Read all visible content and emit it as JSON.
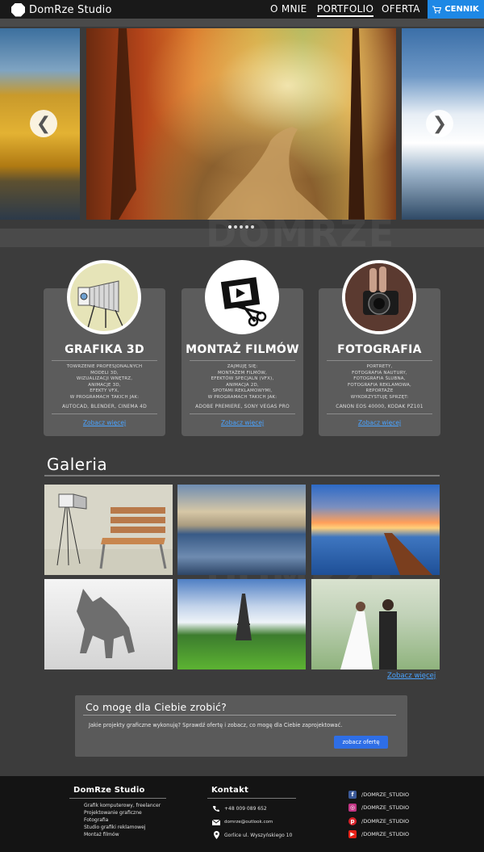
{
  "nav": {
    "brand": "DomRze Studio",
    "links": [
      "O MNIE",
      "PORTFOLIO",
      "OFERTA"
    ],
    "cta": "CENNIK",
    "accent": "#1e88e5"
  },
  "hero": {
    "arrow_left": "❮",
    "arrow_right": "❯",
    "slides": 5,
    "active_slide": 1,
    "watermark": "DOMRZE"
  },
  "services": [
    {
      "title": "GRAFIKA 3D",
      "lines": [
        "TOWRZENIE PROFESJONALNYCH",
        "MODELI 3D,",
        "WIZUALIZACJI WNĘTRZ,",
        "ANIMACJE 3D,",
        "EFEKTY VFX,",
        "W PROGRAMACH TAKICH JAK:"
      ],
      "tools": "AUTOCAD, BLENDER, CINEMA 4D",
      "link": "Zobacz więcej",
      "icon": "camera-3d-icon"
    },
    {
      "title": "MONTAŻ FILMÓW",
      "lines": [
        "ZAJMUJĘ SIĘ:",
        "MONTAŻEM FILMÓW,",
        "EFEKTÓW SPECJALN (VFX),",
        "ANIMACJA 2D,",
        "SPOTAMI REKLAMOWYMI,",
        "W PROGRAMACH TAKICH JAK:"
      ],
      "tools": "ADOBE PREMIERE, SONY VEGAS PRO",
      "link": "Zobacz więcej",
      "icon": "film-edit-icon"
    },
    {
      "title": "FOTOGRAFIA",
      "lines": [
        "PORTRETY,",
        "FOTOGRAFIA NAUTURY,",
        "FOTOGRAFIA ŚLUBNA,",
        "FOTOGRAFIA REKLAMOWA,",
        "REPORTAŻE",
        "WYKORZYSTUJĘ SPRZĘT:"
      ],
      "tools": "CANON EOS 40000, KODAK PZ101",
      "link": "Zobacz więcej",
      "icon": "photo-camera-icon"
    }
  ],
  "gallery": {
    "title": "Galeria",
    "link": "Zobacz więcej",
    "items": [
      "furniture-3d",
      "city-reflection",
      "pier-sunset",
      "creature-3d",
      "eiffel-tower",
      "wedding-couple"
    ]
  },
  "cta": {
    "title": "Co mogę dla Ciebie zrobić?",
    "text": "Jakie projekty graficzne wykonuję? Sprawdź ofertę i zobacz, co mogę dla Ciebie zaprojektować.",
    "button": "zobacz ofertę"
  },
  "footer": {
    "studio_title": "DomRze Studio",
    "studio_items": [
      "Grafik komputerowy, freelancer",
      "Projektowanie graficzne",
      "Fotografia",
      "Studio grafiki reklamowej",
      "Montaż filmów"
    ],
    "contact_title": "Kontakt",
    "phone": "+48 009 089 652",
    "email": "domrze@outlook.com",
    "address": "Gorlice ul. Wyszyńskiego 10",
    "social": [
      {
        "name": "facebook",
        "handle": "/DOMRZE_STUDIO",
        "color": "#3b5998"
      },
      {
        "name": "instagram",
        "handle": "/DOMRZE_STUDIO",
        "color": "#c13584"
      },
      {
        "name": "pinterest",
        "handle": "/DOMRZE_STUDIO",
        "color": "#d8232a"
      },
      {
        "name": "youtube",
        "handle": "/DOMRZE_STUDIO",
        "color": "#e62117"
      }
    ]
  }
}
